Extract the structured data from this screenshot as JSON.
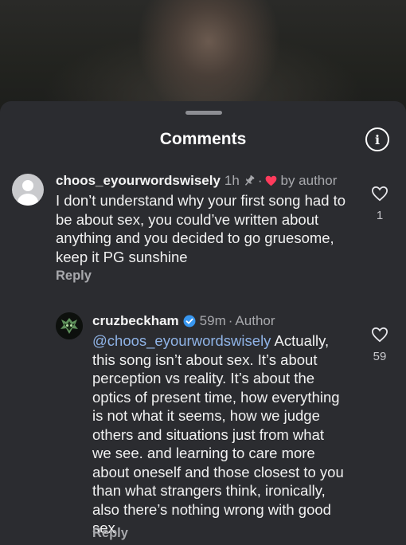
{
  "sheet": {
    "title": "Comments"
  },
  "comments": [
    {
      "username": "choos_eyourwordswisely",
      "time": "1h",
      "liked_by": "by author",
      "text": "I don’t understand why your first song had to be about sex, you could’ve written about anything and you decided to go gruesome, keep it PG sunshine",
      "reply_label": "Reply",
      "likes": "1"
    },
    {
      "username": "cruzbeckham",
      "verified": true,
      "time": "59m",
      "author_tag": "Author",
      "mention": "@choos_eyourwordswisely",
      "text": " Actually, this song isn’t about sex. It’s about perception vs reality. It’s about the optics of present time, how everything is not what it seems, how we judge others and situations  just from what we see. and learning to care more about oneself and those closest to you than what strangers think, ironically, also there’s nothing wrong with good sex",
      "reply_label": "Reply",
      "likes": "59"
    }
  ],
  "colors": {
    "accent_heart": "#ff3b5c",
    "verified": "#3897f0",
    "mention": "#8fb3e6"
  },
  "icons": {
    "info": "info-icon",
    "pin": "pin-icon",
    "heart": "heart-icon",
    "like": "heart-outline-icon",
    "verified": "verified-badge-icon"
  }
}
